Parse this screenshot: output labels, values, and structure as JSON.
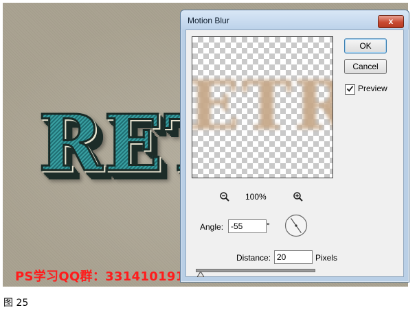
{
  "canvas": {
    "artwork_text": "RET",
    "watermark": "PS学习QQ群：331410191"
  },
  "dialog": {
    "title": "Motion Blur",
    "close_glyph": "x",
    "ok_label": "OK",
    "cancel_label": "Cancel",
    "preview_label": "Preview",
    "preview_checked": true,
    "preview_text": "ETR",
    "zoom_level": "100%",
    "angle_label": "Angle:",
    "angle_value": "-55",
    "degree_symbol": "°",
    "distance_label": "Distance:",
    "distance_value": "20",
    "distance_unit": "Pixels",
    "distance_slider_fraction": 0.04
  },
  "caption": "图 25",
  "colors": {
    "canvas_bg": "#a8a18f",
    "artwork_teal": "#2c8a8e",
    "watermark_red": "#ff1c1c",
    "dialog_frame": "#b9cfe6",
    "close_red": "#c94b33",
    "blur_tan": "#c7a98a"
  }
}
